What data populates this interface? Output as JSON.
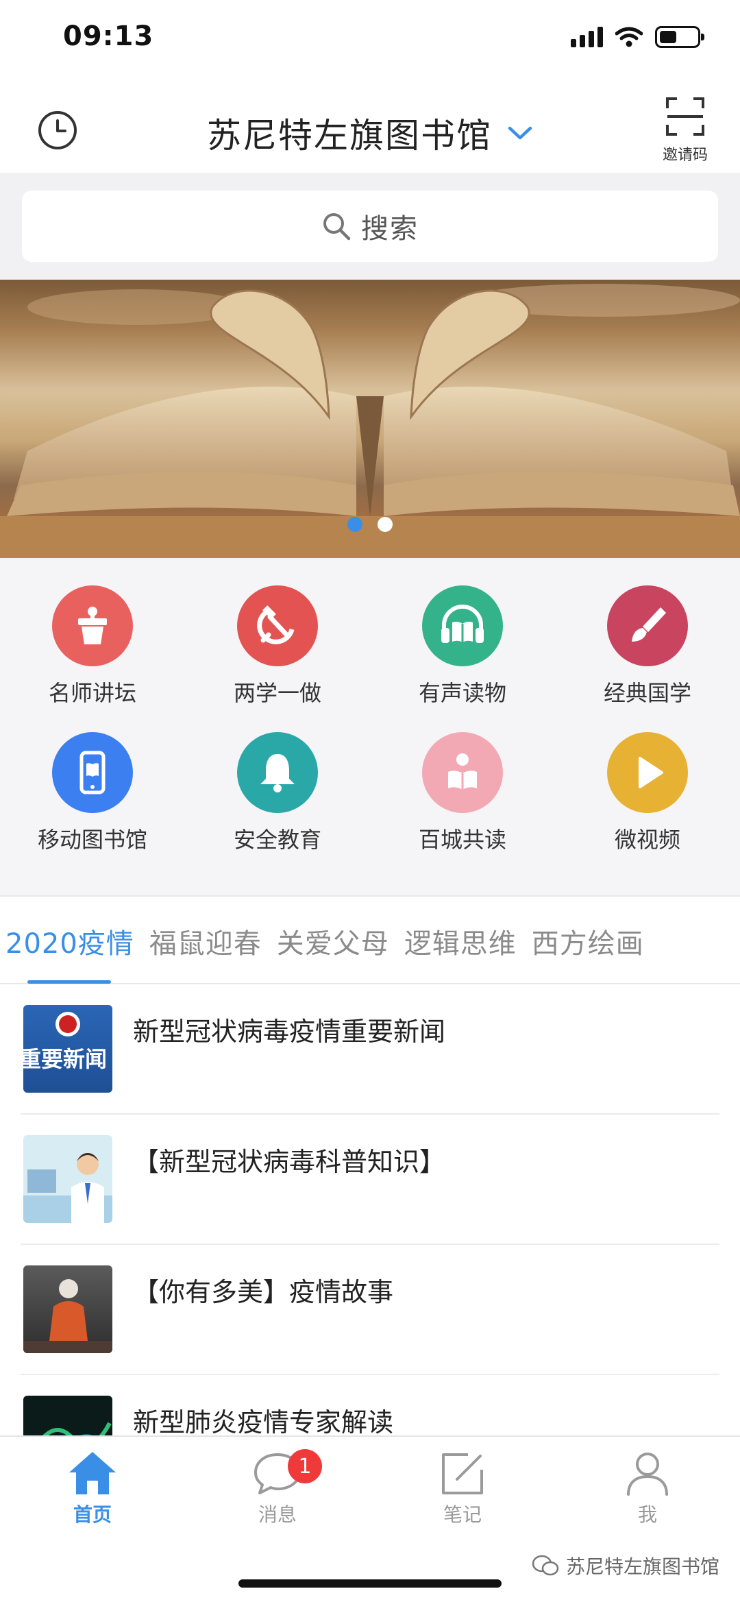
{
  "status_bar": {
    "time": "09:13",
    "battery_level": 0.45
  },
  "header": {
    "title": "苏尼特左旗图书馆",
    "invite_label": "邀请码",
    "icons": {
      "history": "clock-icon",
      "dropdown": "chevron-down-icon",
      "scan": "scan-icon"
    }
  },
  "search": {
    "placeholder": "搜索",
    "icon": "search-icon"
  },
  "banner": {
    "slides": 2,
    "active_slide": 1
  },
  "grid": {
    "items": [
      {
        "label": "名师讲坛",
        "icon": "podium-icon",
        "color": "#e9615f"
      },
      {
        "label": "两学一做",
        "icon": "hammer-sickle-icon",
        "color": "#e25352"
      },
      {
        "label": "有声读物",
        "icon": "headphones-book-icon",
        "color": "#34b38a"
      },
      {
        "label": "经典国学",
        "icon": "brush-icon",
        "color": "#c9455f"
      },
      {
        "label": "移动图书馆",
        "icon": "phone-book-icon",
        "color": "#3b7ff0"
      },
      {
        "label": "安全教育",
        "icon": "bell-icon",
        "color": "#2aa8a8"
      },
      {
        "label": "百城共读",
        "icon": "reader-icon",
        "color": "#f3a9b3"
      },
      {
        "label": "微视频",
        "icon": "play-icon",
        "color": "#e7b134"
      }
    ]
  },
  "tabs": {
    "items": [
      "2020疫情",
      "福鼠迎春",
      "关爱父母",
      "逻辑思维",
      "西方绘画"
    ],
    "active_index": 0
  },
  "list": {
    "items": [
      {
        "title": "新型冠状病毒疫情重要新闻",
        "thumb_text": "重要新闻"
      },
      {
        "title": "【新型冠状病毒科普知识】"
      },
      {
        "title": "【你有多美】疫情故事"
      },
      {
        "title": "新型肺炎疫情专家解读"
      }
    ]
  },
  "bottom_nav": {
    "items": [
      {
        "label": "首页",
        "icon": "home-icon"
      },
      {
        "label": "消息",
        "icon": "chat-bubble-icon",
        "badge": "1"
      },
      {
        "label": "笔记",
        "icon": "note-edit-icon"
      },
      {
        "label": "我",
        "icon": "user-icon"
      }
    ],
    "active_index": 0
  },
  "watermark": {
    "text": "苏尼特左旗图书馆"
  },
  "colors": {
    "accent": "#3a8ee6",
    "badge": "#f03a3a",
    "background": "#f5f5f7"
  }
}
